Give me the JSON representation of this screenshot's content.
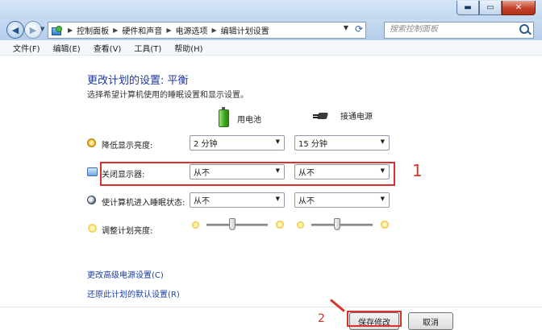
{
  "window": {
    "buttons": {
      "minimize": "▬",
      "maximize": "▭",
      "close": "✕"
    }
  },
  "address_bar": {
    "breadcrumbs": [
      "控制面板",
      "硬件和声音",
      "电源选项",
      "编辑计划设置"
    ],
    "search_placeholder": "搜索控制面板"
  },
  "menu": [
    "文件(F)",
    "编辑(E)",
    "查看(V)",
    "工具(T)",
    "帮助(H)"
  ],
  "page": {
    "title": "更改计划的设置: 平衡",
    "subtitle": "选择希望计算机使用的睡眠设置和显示设置。",
    "columns": {
      "battery": "用电池",
      "plugged_in": "接通电源"
    }
  },
  "settings": [
    {
      "label": "降低显示亮度:",
      "battery": "2 分钟",
      "plugged": "15 分钟"
    },
    {
      "label": "关闭显示器:",
      "battery": "从不",
      "plugged": "从不"
    },
    {
      "label": "使计算机进入睡眠状态:",
      "battery": "从不",
      "plugged": "从不"
    }
  ],
  "brightness": {
    "label": "调整计划亮度:"
  },
  "annotations": {
    "step1": "1",
    "step2": "2"
  },
  "links": {
    "advanced": "更改高级电源设置(C)",
    "restore": "还原此计划的默认设置(R)"
  },
  "buttons": {
    "save": "保存修改",
    "cancel": "取消"
  },
  "colors": {
    "annotation_red": "#d9342b",
    "heading_blue": "#1d3a9b",
    "link_blue": "#1b3ea3"
  }
}
